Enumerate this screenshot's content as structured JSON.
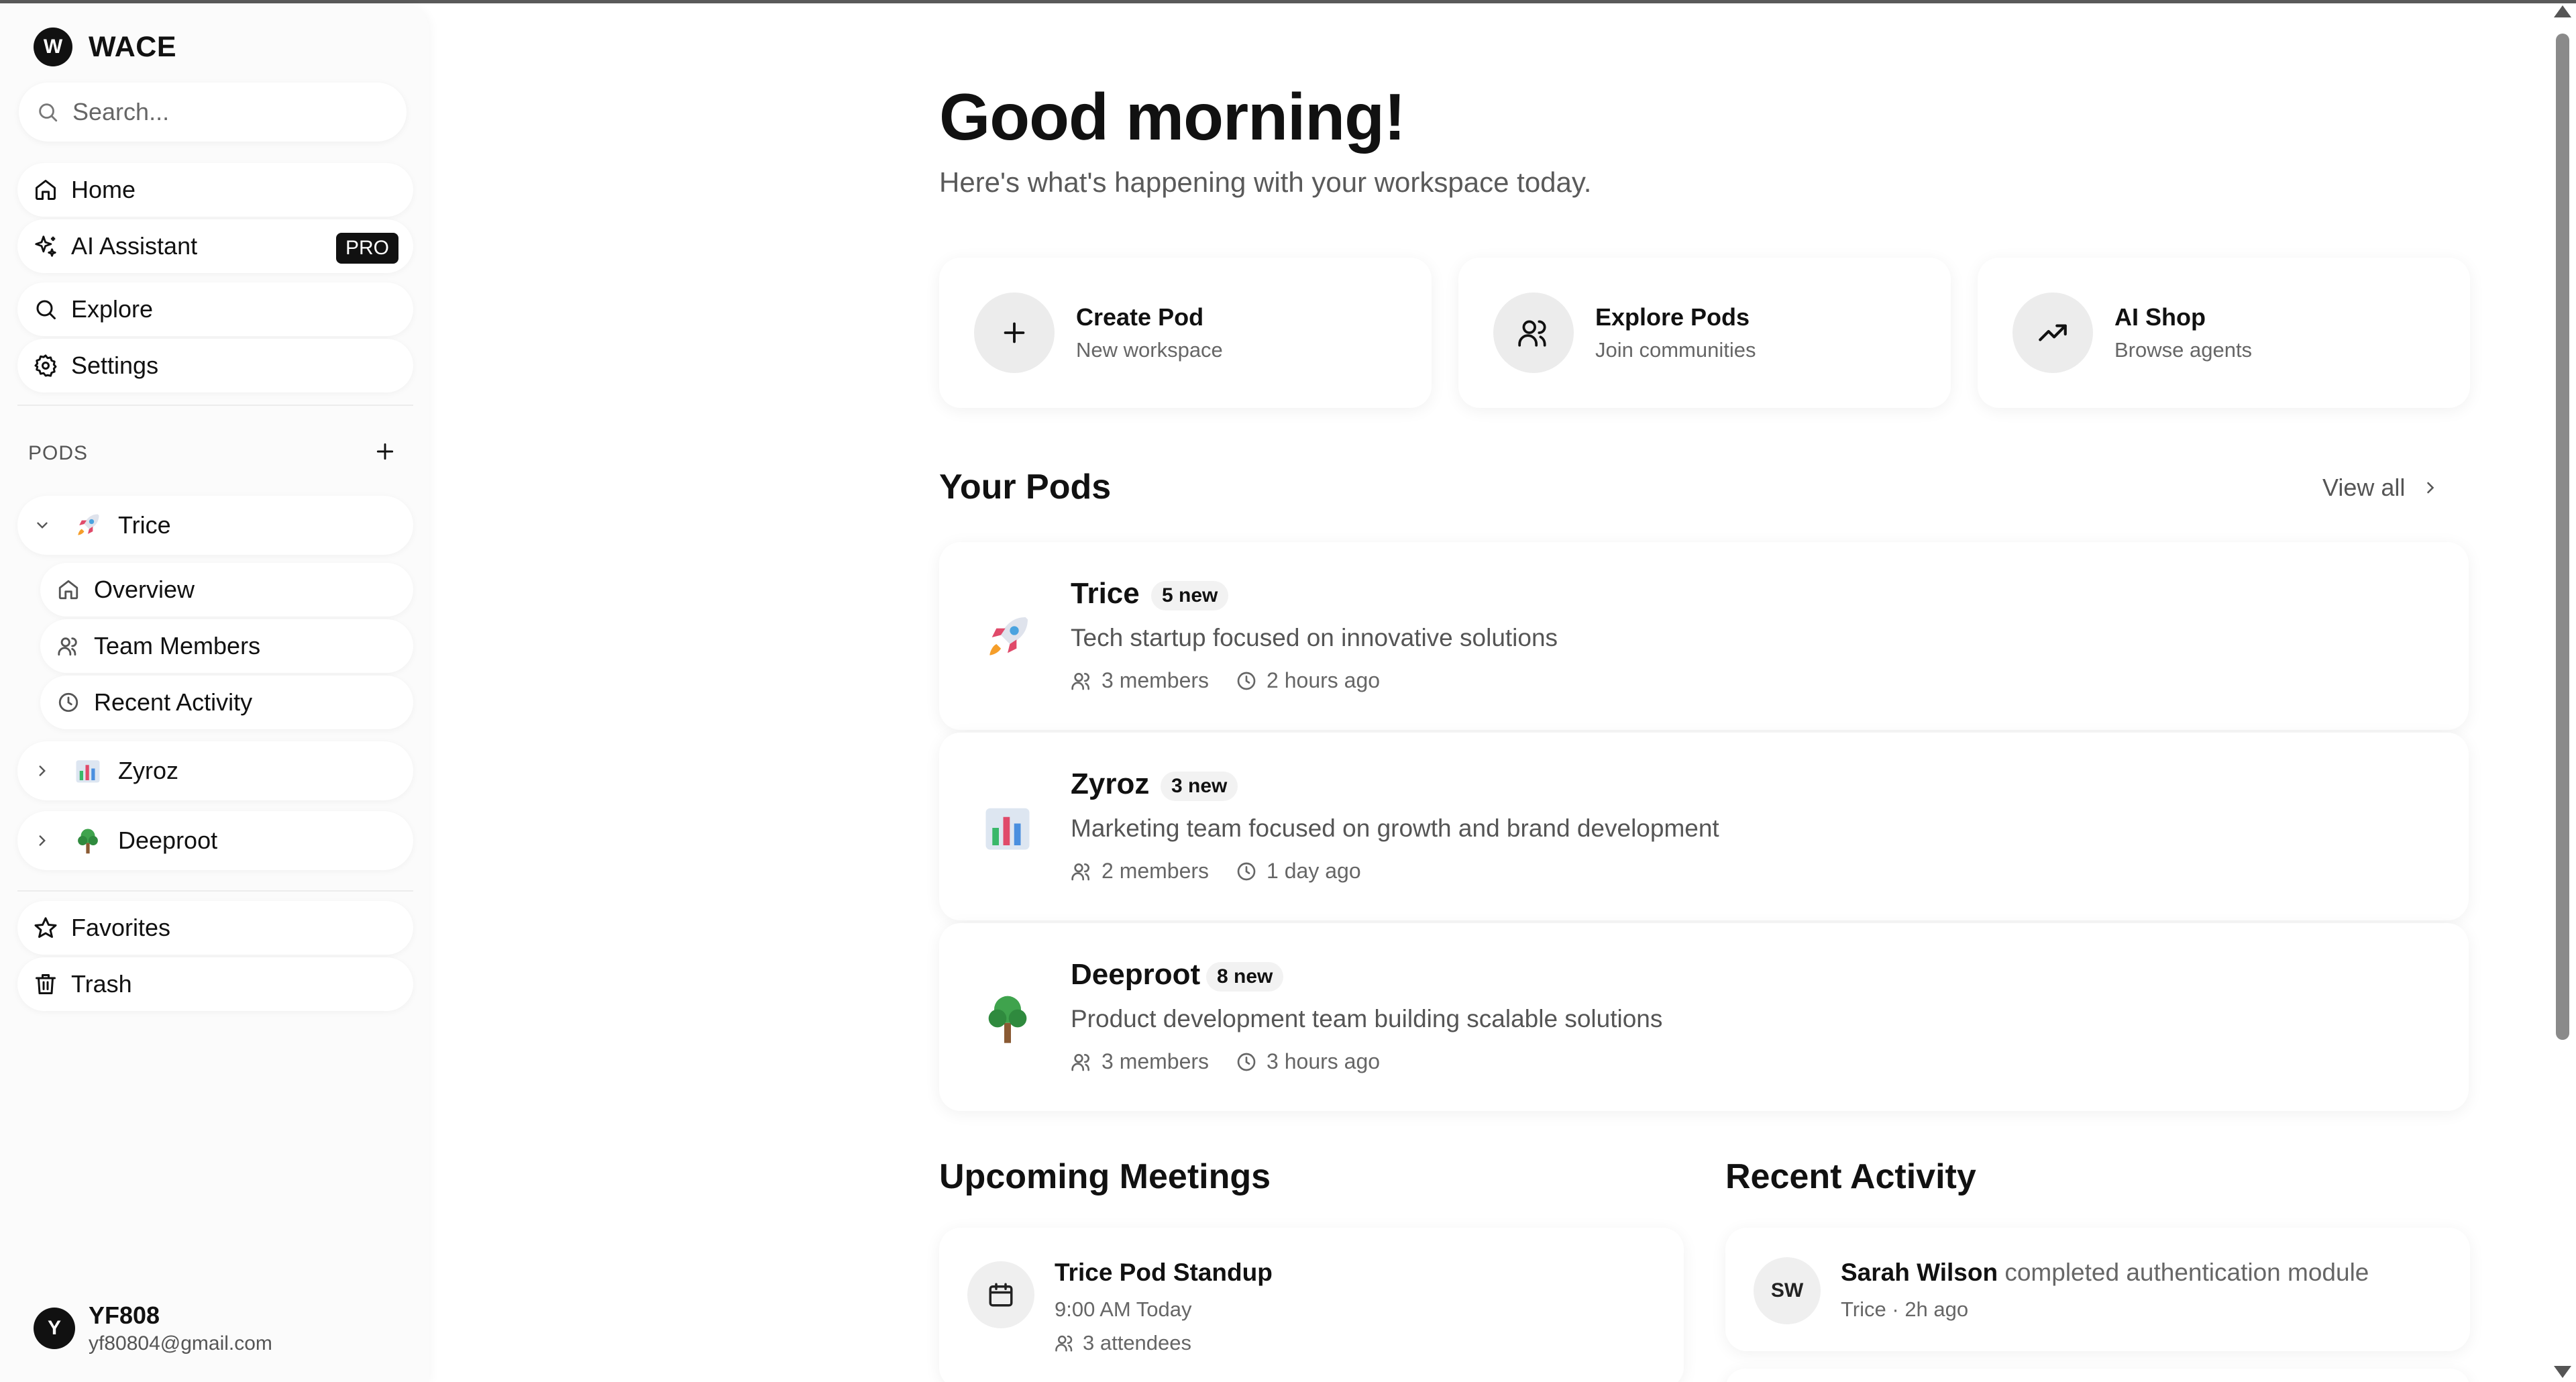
{
  "colors": {
    "accent": "#111111",
    "muted": "#666666",
    "card_bg": "#ffffff",
    "icon_bg": "#ececec"
  },
  "brand": {
    "logo_letter": "W",
    "name": "WACE"
  },
  "search": {
    "placeholder": "Search..."
  },
  "nav": {
    "home": "Home",
    "ai_assistant": "AI Assistant",
    "pro_badge": "PRO",
    "explore": "Explore",
    "settings": "Settings"
  },
  "pods_section": {
    "title": "PODS",
    "pods": [
      {
        "name": "Trice",
        "icon": "rocket-icon",
        "expanded": true
      },
      {
        "name": "Zyroz",
        "icon": "bar-chart-icon",
        "expanded": false
      },
      {
        "name": "Deeproot",
        "icon": "tree-icon",
        "expanded": false
      }
    ],
    "subitems": [
      "Overview",
      "Team Members",
      "Recent Activity"
    ]
  },
  "sidebar_bottom": {
    "favorites": "Favorites",
    "trash": "Trash"
  },
  "user": {
    "initial": "Y",
    "name": "YF808",
    "email": "yf80804@gmail.com"
  },
  "header": {
    "greeting": "Good morning!",
    "subtitle": "Here's what's happening with your workspace today."
  },
  "actions": [
    {
      "title": "Create Pod",
      "subtitle": "New workspace",
      "icon": "plus-icon"
    },
    {
      "title": "Explore Pods",
      "subtitle": "Join communities",
      "icon": "users-icon"
    },
    {
      "title": "AI Shop",
      "subtitle": "Browse agents",
      "icon": "trending-up-icon"
    }
  ],
  "your_pods": {
    "title": "Your Pods",
    "view_all": "View all",
    "items": [
      {
        "name": "Trice",
        "badge": "5 new",
        "description": "Tech startup focused on innovative solutions",
        "members": "3 members",
        "updated": "2 hours ago",
        "icon": "rocket-icon"
      },
      {
        "name": "Zyroz",
        "badge": "3 new",
        "description": "Marketing team focused on growth and brand development",
        "members": "2 members",
        "updated": "1 day ago",
        "icon": "bar-chart-icon"
      },
      {
        "name": "Deeproot",
        "badge": "8 new",
        "description": "Product development team building scalable solutions",
        "members": "3 members",
        "updated": "3 hours ago",
        "icon": "tree-icon"
      }
    ]
  },
  "meetings": {
    "title": "Upcoming Meetings",
    "items": [
      {
        "title": "Trice Pod Standup",
        "time": "9:00 AM Today",
        "attendees": "3 attendees"
      }
    ]
  },
  "activity": {
    "title": "Recent Activity",
    "items": [
      {
        "initials": "SW",
        "actor": "Sarah Wilson",
        "action": " completed authentication module",
        "pod": "Trice",
        "separator": " · ",
        "time": "2h ago"
      }
    ]
  }
}
